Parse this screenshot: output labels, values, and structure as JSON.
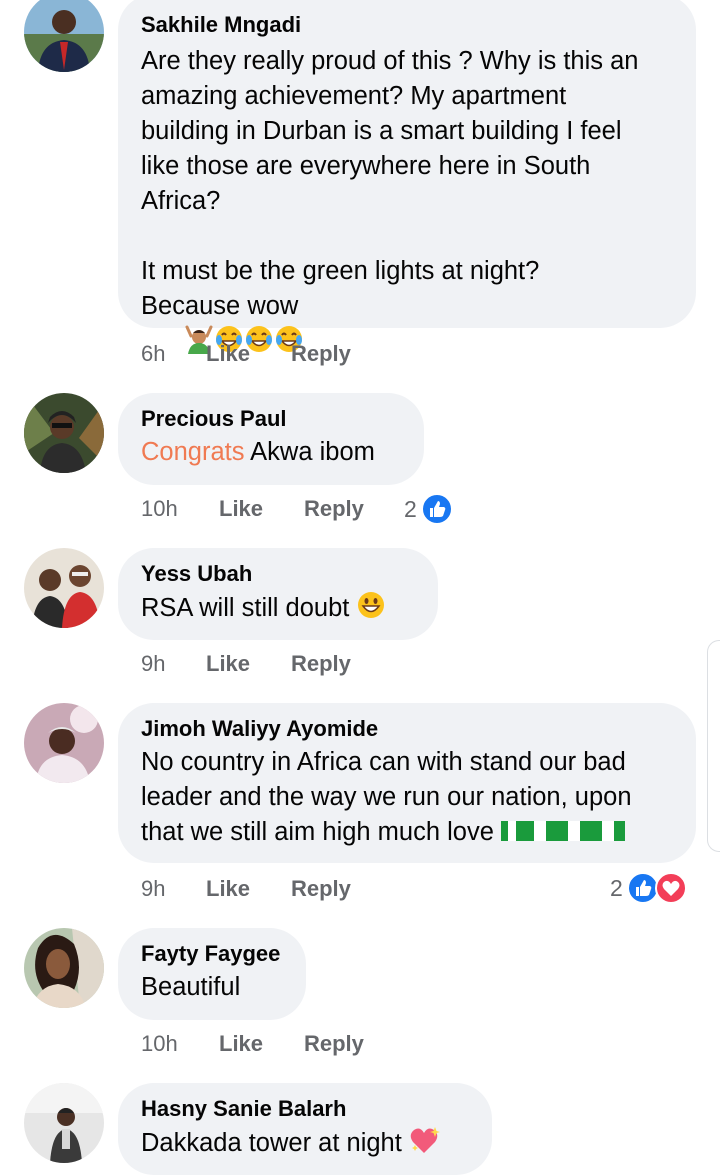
{
  "comments": [
    {
      "name": "Sakhile Mngadi",
      "text": "Are they really proud of this ? Why is this an\namazing achievement? My apartment\nbuilding in Durban is a smart building I feel\nlike those are everywhere here in South\nAfrica?\n\nIt must be the green lights at night?\nBecause wow",
      "emoji": [
        "person-gesturing-ok-emoji",
        "tears-of-joy-emoji",
        "tears-of-joy-emoji",
        "tears-of-joy-emoji"
      ],
      "time": "6h",
      "like": "Like",
      "reply": "Reply"
    },
    {
      "name": "Precious Paul",
      "tag": "Congrats",
      "text": " Akwa ibom",
      "time": "10h",
      "like": "Like",
      "reply": "Reply",
      "reaction_count": "2"
    },
    {
      "name": "Yess Ubah",
      "text": "RSA will still doubt",
      "emoji": [
        "grinning-face-emoji"
      ],
      "time": "9h",
      "like": "Like",
      "reply": "Reply"
    },
    {
      "name": "Jimoh Waliyy Ayomide",
      "text": "No country in Africa can with stand our bad\nleader and the way we run our nation, upon\nthat we still aim high much love",
      "emoji": [
        "nigeria-flag-emoji",
        "nigeria-flag-emoji",
        "nigeria-flag-emoji",
        "nigeria-flag-emoji"
      ],
      "time": "9h",
      "like": "Like",
      "reply": "Reply",
      "reaction_count": "2"
    },
    {
      "name": "Fayty Faygee",
      "text": "Beautiful",
      "time": "10h",
      "like": "Like",
      "reply": "Reply"
    },
    {
      "name": "Hasny Sanie Balarh",
      "text": "Dakkada tower at night",
      "emoji": [
        "sparkling-heart-emoji"
      ],
      "time": "",
      "like": "",
      "reply": ""
    }
  ],
  "colors": {
    "bubble": "#f0f2f5",
    "meta": "#65676b",
    "tag": "#f07a52",
    "like_blue": "#1877f2",
    "love_red": "#f33e58"
  }
}
